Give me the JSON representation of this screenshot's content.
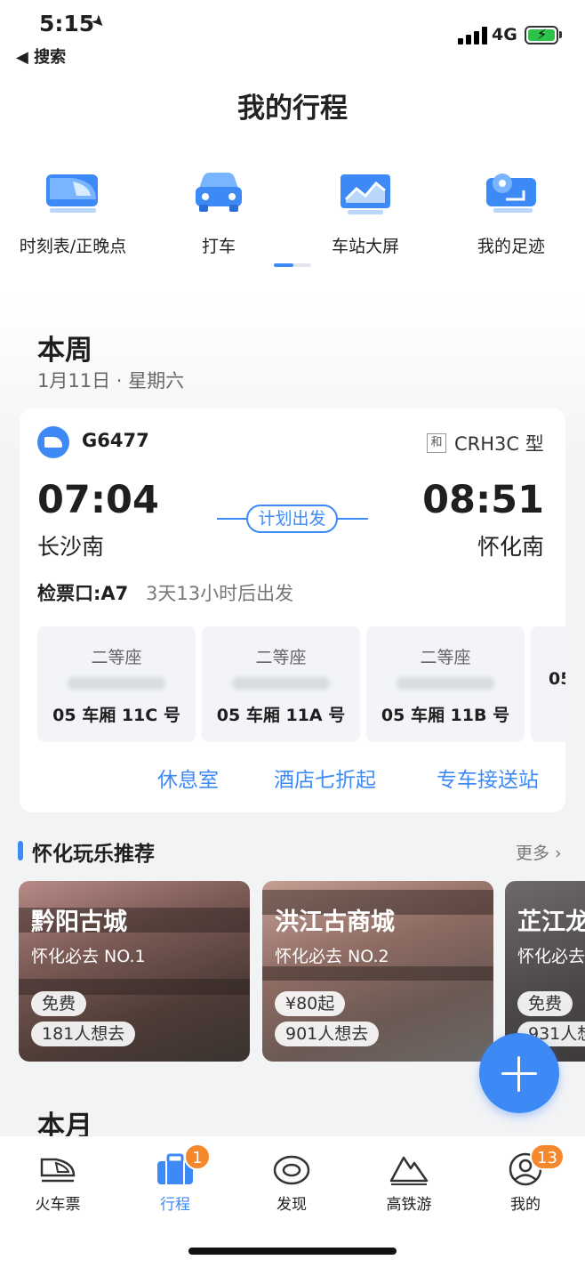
{
  "status": {
    "time": "5:15",
    "back_label": "◀ 搜索",
    "network": "4G"
  },
  "page_title": "我的行程",
  "quick_entries": [
    {
      "label": "时刻表/正晚点",
      "icon": "train-icon"
    },
    {
      "label": "打车",
      "icon": "car-icon"
    },
    {
      "label": "车站大屏",
      "icon": "screen-icon"
    },
    {
      "label": "我的足迹",
      "icon": "footprint-icon"
    }
  ],
  "week": {
    "title": "本周",
    "date": "1月11日 · 星期六"
  },
  "trip": {
    "train_no": "G6477",
    "train_type_badge": "和",
    "train_type": "CRH3C 型",
    "dep_time": "07:04",
    "arr_time": "08:51",
    "dep_station": "长沙南",
    "arr_station": "怀化南",
    "status": "计划出发",
    "gate": "检票口:A7",
    "countdown": "3天13小时后出发",
    "seats": [
      {
        "class": "二等座",
        "position": "05 车厢 11C 号"
      },
      {
        "class": "二等座",
        "position": "05 车厢 11A 号"
      },
      {
        "class": "二等座",
        "position": "05 车厢 11B 号"
      },
      {
        "class": "",
        "position": "05"
      }
    ],
    "links": [
      "休息室",
      "酒店七折起",
      "专车接送站"
    ]
  },
  "recommend": {
    "title": "怀化玩乐推荐",
    "more": "更多",
    "places": [
      {
        "name": "黔阳古城",
        "sub": "怀化必去 NO.1",
        "price": "免费",
        "want": "181人想去"
      },
      {
        "name": "洪江古商城",
        "sub": "怀化必去 NO.2",
        "price": "¥80起",
        "want": "901人想去"
      },
      {
        "name": "芷江龙",
        "sub": "怀化必去",
        "price": "免费",
        "want": "931人想"
      }
    ]
  },
  "month": {
    "title": "本月"
  },
  "tabs": [
    {
      "label": "火车票",
      "icon": "train-ticket-icon"
    },
    {
      "label": "行程",
      "icon": "suitcase-icon",
      "badge": "1"
    },
    {
      "label": "发现",
      "icon": "eye-icon"
    },
    {
      "label": "高铁游",
      "icon": "mountain-icon"
    },
    {
      "label": "我的",
      "icon": "user-icon",
      "badge": "13"
    }
  ],
  "colors": {
    "accent": "#3d8af7",
    "badge": "#f5882c"
  }
}
